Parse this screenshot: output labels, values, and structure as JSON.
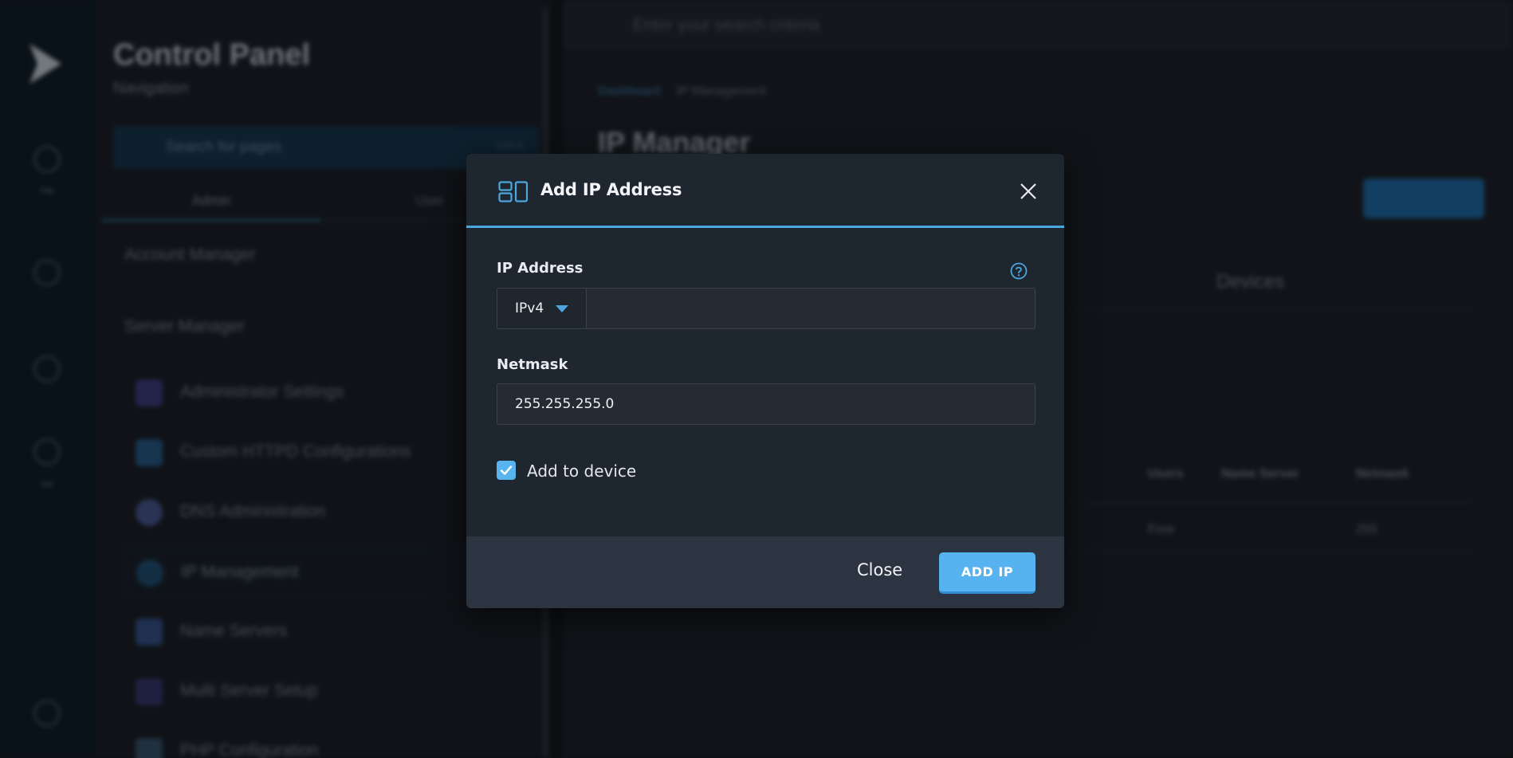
{
  "background": {
    "rail": {
      "labels": [
        "File",
        "Ver"
      ]
    },
    "nav": {
      "title": "Control Panel",
      "subtitle": "Navigation",
      "search_placeholder": "Search for pages",
      "search_key": "Ctrl K",
      "tabs": [
        "Admin",
        "User"
      ],
      "sections": [
        "Account Manager",
        "Server Manager"
      ],
      "items": [
        {
          "label": "Administrator Settings",
          "color": "#5a55b8"
        },
        {
          "label": "Custom HTTPD Configurations",
          "color": "#2e6fa8"
        },
        {
          "label": "DNS Administration",
          "color": "#6a7ab8"
        },
        {
          "label": "IP Management",
          "color": "#2a6a98"
        },
        {
          "label": "Name Servers",
          "color": "#4a68a8"
        },
        {
          "label": "Multi Server Setup",
          "color": "#4c4aa0"
        },
        {
          "label": "PHP Configuration",
          "color": "#4a6a8a"
        }
      ]
    },
    "main": {
      "search_placeholder": "Enter your search criteria",
      "breadcrumb": [
        "Dashboard",
        "IP Management"
      ],
      "title": "IP Manager",
      "tab": "Devices",
      "headers": [
        "Users",
        "Name Server",
        "Netmask"
      ],
      "row_values": [
        "Free",
        "255"
      ]
    }
  },
  "modal": {
    "title": "Add IP Address",
    "ip_label": "IP Address",
    "ip_version": "IPv4",
    "ip_value": "",
    "netmask_label": "Netmask",
    "netmask_value": "255.255.255.0",
    "checkbox_label": "Add to device",
    "checkbox_checked": true,
    "close_label": "Close",
    "add_label": "ADD IP"
  },
  "colors": {
    "accent": "#56b3ef",
    "modal_bg": "#1e2630",
    "footer_bg": "#2b3440"
  }
}
